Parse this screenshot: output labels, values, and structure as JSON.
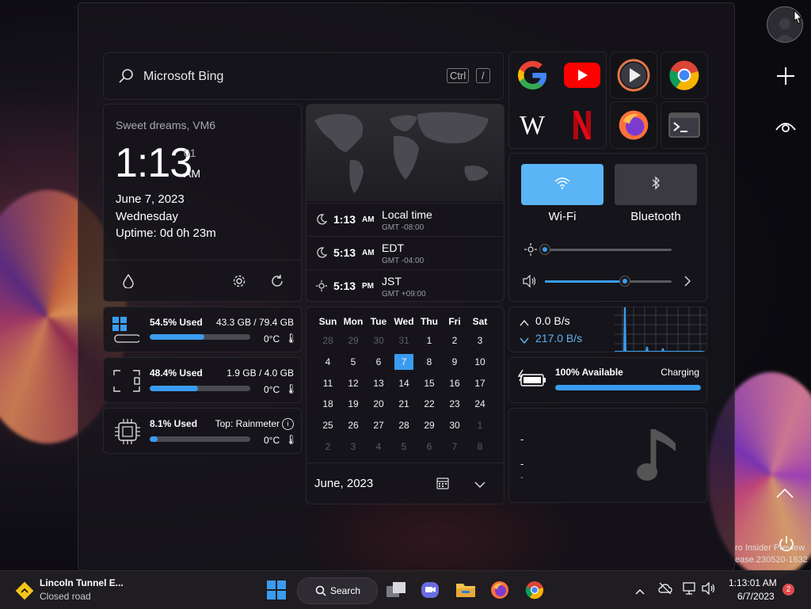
{
  "search": {
    "placeholder": "Microsoft Bing",
    "shortcut_ctrl": "Ctrl",
    "shortcut_key": "/"
  },
  "clock": {
    "greeting": "Sweet dreams, VM6",
    "time": "1:13",
    "seconds": "01",
    "ampm": "AM",
    "date": "June 7, 2023",
    "weekday": "Wednesday",
    "uptime": "Uptime: 0d 0h 23m"
  },
  "world_clocks": [
    {
      "time": "1:13",
      "ampm": "AM",
      "name": "Local time",
      "offset": "GMT -08:00",
      "icon": "moon-icon"
    },
    {
      "time": "5:13",
      "ampm": "AM",
      "name": "EDT",
      "offset": "GMT -04:00",
      "icon": "moon-icon"
    },
    {
      "time": "5:13",
      "ampm": "PM",
      "name": "JST",
      "offset": "GMT +09:00",
      "icon": "sun-icon"
    }
  ],
  "apps": [
    "google",
    "youtube",
    "media-player",
    "chrome",
    "wikipedia",
    "netflix",
    "firefox",
    "terminal"
  ],
  "quick": {
    "wifi_label": "Wi-Fi",
    "bluetooth_label": "Bluetooth",
    "brightness_level": 0.0,
    "volume_level": 0.63
  },
  "storage": {
    "used": "54.5% Used",
    "size": "43.3 GB / 79.4 GB",
    "temp": "0°C",
    "percent": 54.5
  },
  "memory": {
    "used": "48.4% Used",
    "size": "1.9 GB / 4.0 GB",
    "temp": "0°C",
    "percent": 48.4
  },
  "cpu": {
    "used": "8.1% Used",
    "top": "Top: Rainmeter",
    "temp": "0°C",
    "percent": 8.1
  },
  "calendar": {
    "days": [
      "Sun",
      "Mon",
      "Tue",
      "Wed",
      "Thu",
      "Fri",
      "Sat"
    ],
    "weeks": [
      [
        "28",
        "29",
        "30",
        "31",
        "1",
        "2",
        "3"
      ],
      [
        "4",
        "5",
        "6",
        "7",
        "8",
        "9",
        "10"
      ],
      [
        "11",
        "12",
        "13",
        "14",
        "15",
        "16",
        "17"
      ],
      [
        "18",
        "19",
        "20",
        "21",
        "22",
        "23",
        "24"
      ],
      [
        "25",
        "26",
        "27",
        "28",
        "29",
        "30",
        "1"
      ],
      [
        "2",
        "3",
        "4",
        "5",
        "6",
        "7",
        "8"
      ]
    ],
    "month_label": "June, 2023",
    "today": "7"
  },
  "network": {
    "up": "0.0 B/s",
    "down": "217.0 B/s"
  },
  "battery": {
    "status": "100% Available",
    "state": "Charging",
    "percent": 100
  },
  "media": {
    "line1": "-",
    "line2": "-",
    "line3": "-"
  },
  "taskbar": {
    "notif_title": "Lincoln Tunnel E...",
    "notif_sub": "Closed road",
    "search_label": "Search",
    "time": "1:13:01 AM",
    "date": "6/7/2023",
    "badge": "2"
  },
  "watermark": {
    "line1": "ro Insider Preview",
    "line2": "ease.230520-1632"
  },
  "colors": {
    "accent": "#3a9cf0",
    "wifi_on": "#5ab4f5"
  }
}
